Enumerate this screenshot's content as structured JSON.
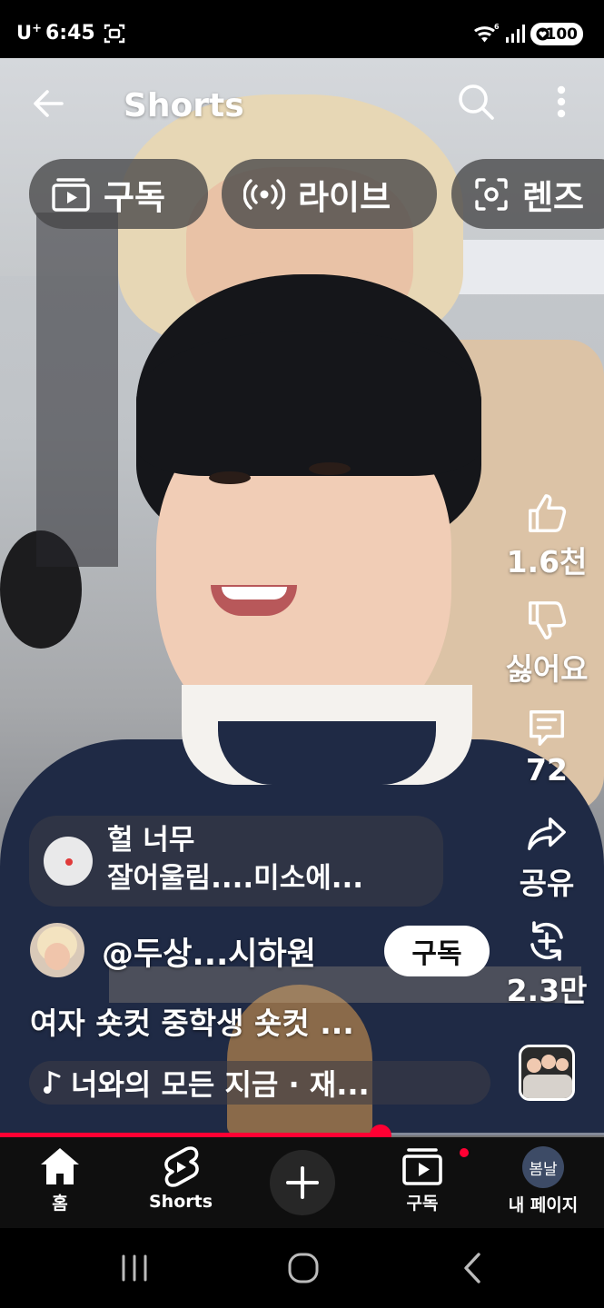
{
  "status_bar": {
    "carrier": "U",
    "carrier_sup": "+",
    "time": "6:45",
    "battery": "100"
  },
  "header": {
    "title": "Shorts"
  },
  "chips": [
    {
      "label": "구독",
      "icon": "subscriptions-icon"
    },
    {
      "label": "라이브",
      "icon": "live-icon"
    },
    {
      "label": "렌즈",
      "icon": "lens-icon"
    }
  ],
  "actions": {
    "like": "1.6천",
    "dislike": "싫어요",
    "comments": "72",
    "share": "공유",
    "remix": "2.3만"
  },
  "comment_preview": {
    "text": "헐 너무\n잘어울림....미소에..."
  },
  "channel": {
    "name": "@두상...시하원",
    "subscribe_label": "구독"
  },
  "video": {
    "title": "여자 숏컷 중학생 숏컷  ...",
    "music": "너와의 모든 지금 · 재...",
    "progress": 0.63
  },
  "bottom_nav": {
    "home": "홈",
    "shorts": "Shorts",
    "subscriptions": "구독",
    "my_page": "내 페이지",
    "my_page_avatar_text": "봄날"
  },
  "colors": {
    "accent": "#ff0033",
    "nav_bg": "#0f0f0f",
    "chip_bg": "#464648"
  }
}
